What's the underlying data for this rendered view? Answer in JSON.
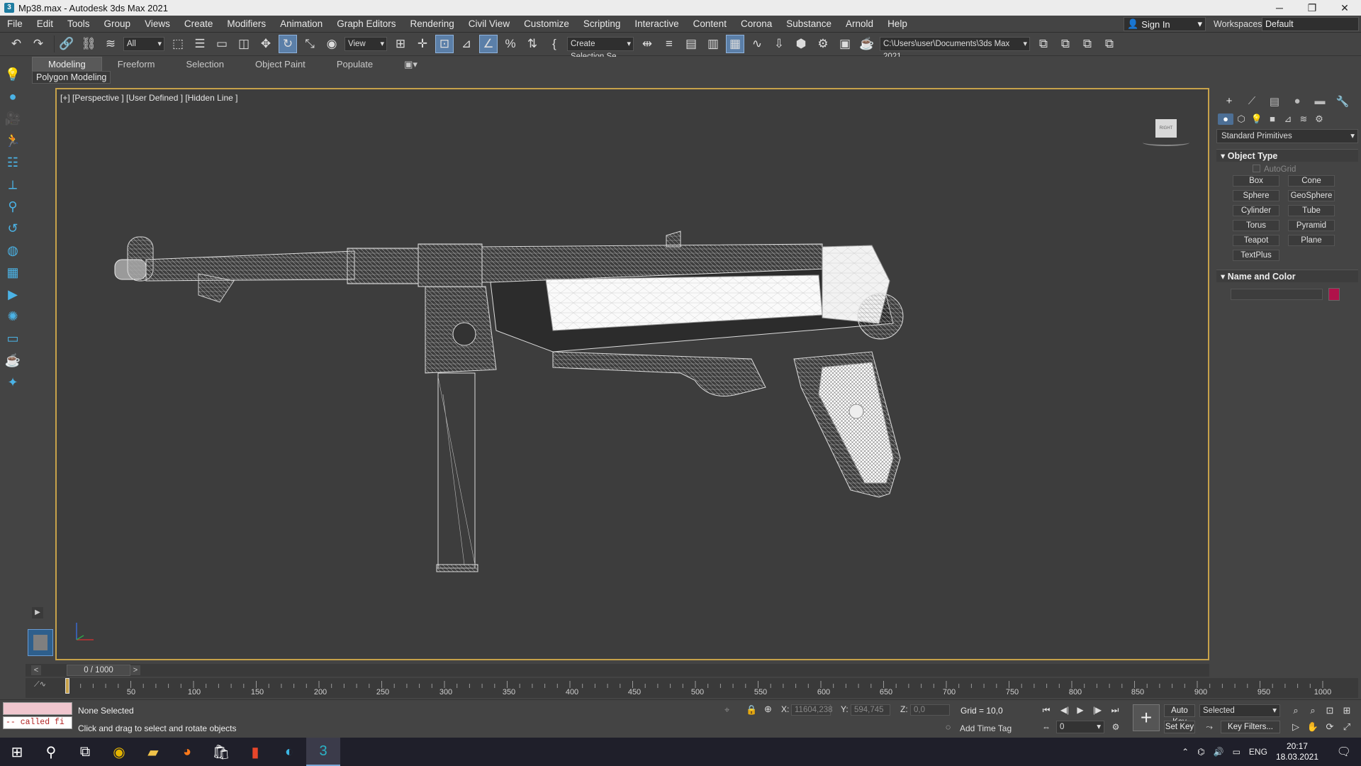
{
  "window": {
    "title": "Mp38.max - Autodesk 3ds Max 2021"
  },
  "menubar": {
    "items": [
      "File",
      "Edit",
      "Tools",
      "Group",
      "Views",
      "Create",
      "Modifiers",
      "Animation",
      "Graph Editors",
      "Rendering",
      "Civil View",
      "Customize",
      "Scripting",
      "Interactive",
      "Content",
      "Corona",
      "Substance",
      "Arnold",
      "Help"
    ],
    "sign_in": "Sign In",
    "workspaces_label": "Workspaces:",
    "workspace_value": "Default"
  },
  "toolbar": {
    "selection_filter": "All",
    "reference_coord": "View",
    "named_selection": "Create Selection Se",
    "project_path": "C:\\Users\\user\\Documents\\3ds Max 2021"
  },
  "ribbon": {
    "tabs": [
      "Modeling",
      "Freeform",
      "Selection",
      "Object Paint",
      "Populate"
    ],
    "active_tab": "Modeling",
    "sub_panel": "Polygon Modeling"
  },
  "viewport": {
    "label": "[+] [Perspective ] [User Defined ] [Hidden Line ]",
    "viewcube_face": "RIGHT"
  },
  "command_panel": {
    "category": "Standard Primitives",
    "object_type_title": "Object Type",
    "autogrid": "AutoGrid",
    "primitives": [
      "Box",
      "Cone",
      "Sphere",
      "GeoSphere",
      "Cylinder",
      "Tube",
      "Torus",
      "Pyramid",
      "Teapot",
      "Plane",
      "TextPlus"
    ],
    "name_color_title": "Name and Color",
    "object_color": "#b0124a"
  },
  "timeline": {
    "frame_display": "0 / 1000",
    "ticks": [
      "50",
      "100",
      "150",
      "200",
      "250",
      "300",
      "350",
      "400",
      "450",
      "500",
      "550",
      "600",
      "650",
      "700",
      "750",
      "800",
      "850",
      "900",
      "950",
      "1000"
    ]
  },
  "status": {
    "script_output": "-- called fi",
    "selection": "None Selected",
    "prompt": "Click and drag to select and rotate objects",
    "x_label": "X:",
    "x_value": "11604,238",
    "y_label": "Y:",
    "y_value": "594,745",
    "z_label": "Z:",
    "z_value": "0,0",
    "grid": "Grid = 10,0",
    "add_time_tag": "Add Time Tag",
    "frame_field": "0",
    "auto_key": "Auto Key",
    "set_key": "Set Key",
    "key_mode": "Selected",
    "key_filters": "Key Filters..."
  },
  "taskbar": {
    "language": "ENG",
    "time": "20:17",
    "date": "18.03.2021"
  }
}
